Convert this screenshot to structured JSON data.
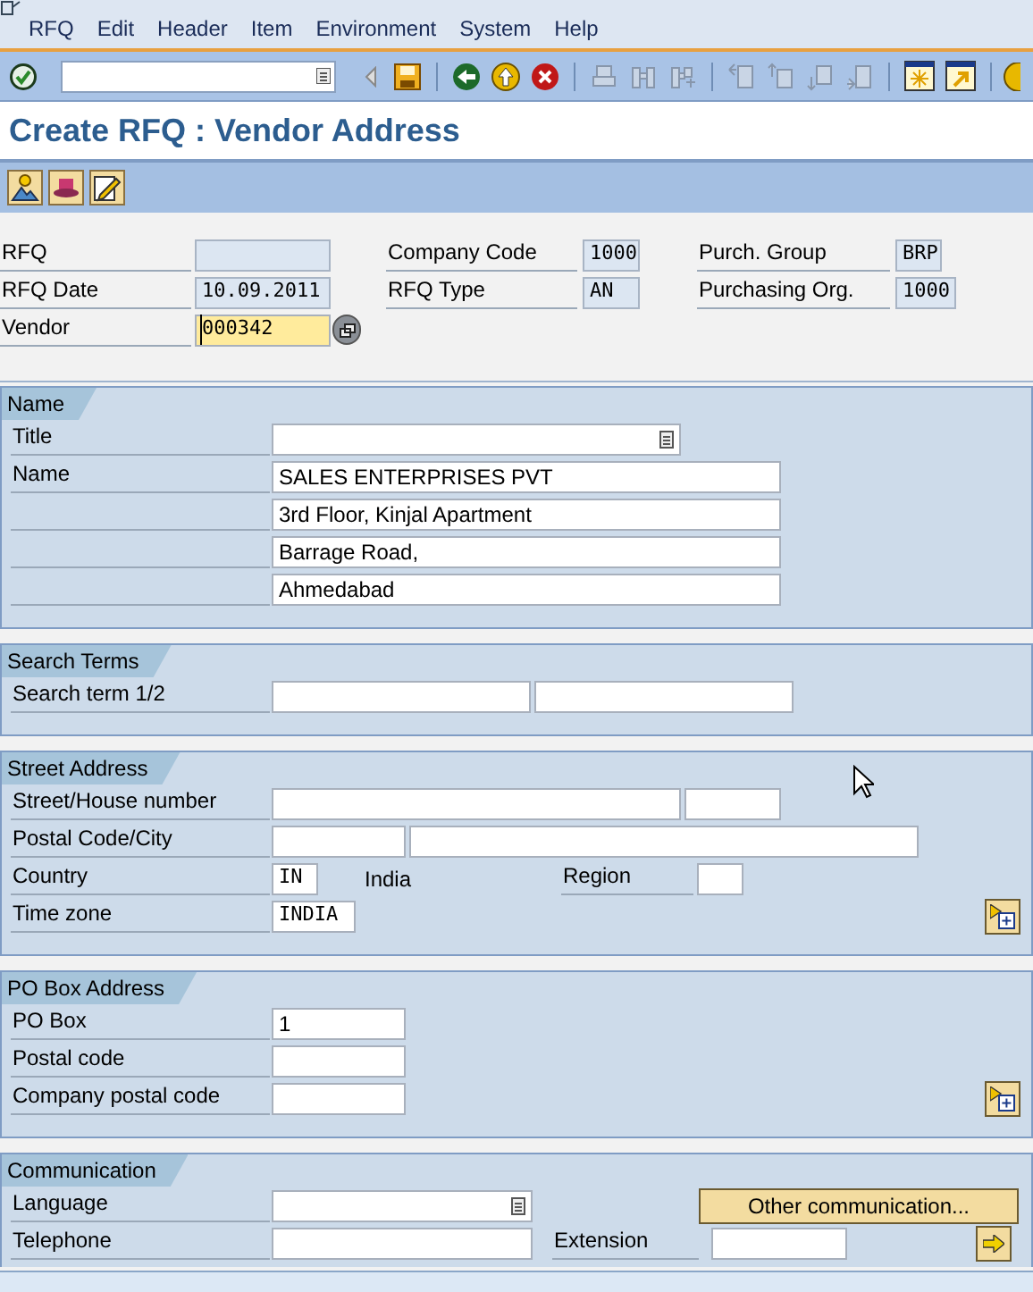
{
  "menu": [
    {
      "label": "RFQ"
    },
    {
      "label": "Edit"
    },
    {
      "label": "Header"
    },
    {
      "label": "Item"
    },
    {
      "label": "Environment"
    },
    {
      "label": "System"
    },
    {
      "label": "Help"
    }
  ],
  "title": "Create RFQ : Vendor Address",
  "header": {
    "rows": [
      [
        {
          "kind": "label",
          "text": "RFQ"
        },
        {
          "kind": "output"
        },
        {
          "kind": "label",
          "text": "Company Code"
        },
        {
          "kind": "output",
          "value": "1000"
        },
        {
          "kind": "label",
          "text": "Purch. Group"
        },
        {
          "kind": "output",
          "value": "BRP"
        }
      ],
      [
        {
          "kind": "label",
          "text": "RFQ Date"
        },
        {
          "kind": "output",
          "value": "10.09.2011"
        },
        {
          "kind": "label",
          "text": "RFQ Type"
        },
        {
          "kind": "output",
          "value": "AN"
        },
        {
          "kind": "label",
          "text": "Purchasing Org."
        },
        {
          "kind": "output",
          "value": "1000"
        }
      ],
      [
        {
          "kind": "label",
          "text": "Vendor"
        },
        {
          "kind": "input",
          "value": "000342",
          "focused": true
        },
        {
          "kind": "match_button"
        }
      ]
    ]
  },
  "sections": [
    {
      "title": "Name",
      "rows": [
        [
          {
            "kind": "label",
            "text": "Title"
          },
          {
            "kind": "dropdown"
          }
        ],
        [
          {
            "kind": "label",
            "text": "Name"
          },
          {
            "kind": "input",
            "value": "SALES ENTERPRISES PVT"
          }
        ],
        [
          {
            "kind": "rule"
          },
          {
            "kind": "input",
            "value": "3rd Floor, Kinjal Apartment"
          }
        ],
        [
          {
            "kind": "rule"
          },
          {
            "kind": "input",
            "value": "Barrage Road,"
          }
        ],
        [
          {
            "kind": "rule"
          },
          {
            "kind": "input",
            "value": "Ahmedabad"
          }
        ]
      ]
    },
    {
      "title": "Search Terms",
      "rows": [
        [
          {
            "kind": "label",
            "text": "Search term 1/2"
          },
          {
            "kind": "input"
          },
          {
            "kind": "input"
          }
        ]
      ]
    },
    {
      "title": "Street Address",
      "rows": [
        [
          {
            "kind": "label",
            "text": "Street/House number"
          },
          {
            "kind": "input"
          },
          {
            "kind": "input"
          }
        ],
        [
          {
            "kind": "label",
            "text": "Postal Code/City"
          },
          {
            "kind": "input"
          },
          {
            "kind": "input"
          }
        ],
        [
          {
            "kind": "label",
            "text": "Country"
          },
          {
            "kind": "code",
            "value": "IN"
          },
          {
            "kind": "text",
            "text": "India"
          },
          {
            "kind": "label",
            "text": "Region"
          },
          {
            "kind": "input"
          }
        ],
        [
          {
            "kind": "label",
            "text": "Time zone"
          },
          {
            "kind": "code",
            "value": "INDIA"
          },
          {
            "kind": "detail_button"
          }
        ]
      ]
    },
    {
      "title": "PO Box Address",
      "rows": [
        [
          {
            "kind": "label",
            "text": "PO Box"
          },
          {
            "kind": "input",
            "value": "1"
          }
        ],
        [
          {
            "kind": "label",
            "text": "Postal code"
          },
          {
            "kind": "input"
          }
        ],
        [
          {
            "kind": "label",
            "text": "Company postal code"
          },
          {
            "kind": "input"
          },
          {
            "kind": "detail_button"
          }
        ]
      ]
    },
    {
      "title": "Communication",
      "rows": [
        [
          {
            "kind": "label",
            "text": "Language"
          },
          {
            "kind": "dropdown"
          },
          {
            "kind": "button",
            "text": "Other communication..."
          }
        ],
        [
          {
            "kind": "label",
            "text": "Telephone"
          },
          {
            "kind": "input"
          },
          {
            "kind": "label",
            "text": "Extension"
          },
          {
            "kind": "input"
          },
          {
            "kind": "arrow_button"
          }
        ]
      ]
    }
  ]
}
